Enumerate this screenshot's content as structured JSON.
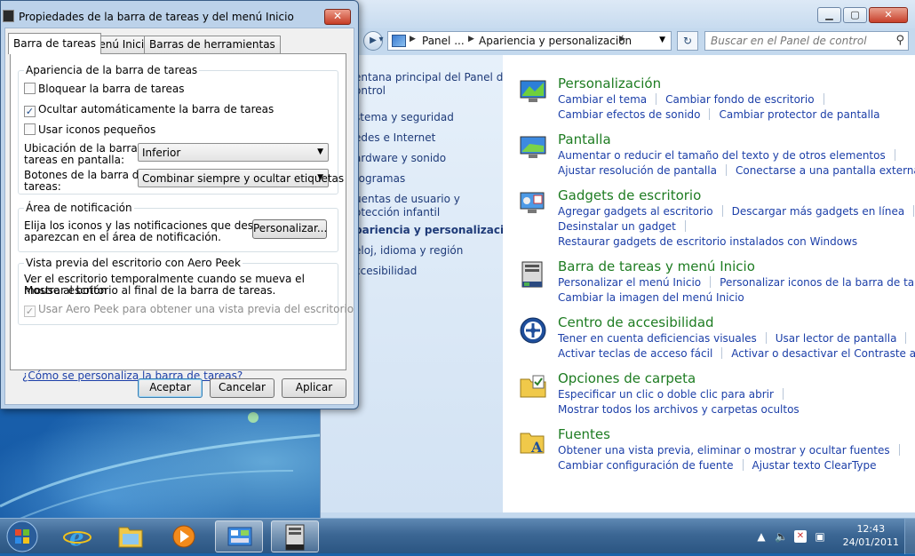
{
  "dialog": {
    "title": "Propiedades de la barra de tareas y del menú Inicio",
    "close": "✕",
    "tabs": [
      "Barra de tareas",
      "Menú Inicio",
      "Barras de herramientas"
    ],
    "appearance": {
      "title": "Apariencia de la barra de tareas",
      "lock": {
        "label": "Bloquear la barra de tareas",
        "checked": false
      },
      "autohide": {
        "label": "Ocultar automáticamente la barra de tareas",
        "checked": true
      },
      "small_icons": {
        "label": "Usar iconos pequeños",
        "checked": false
      },
      "location_label_1": "Ubicación de la barra de",
      "location_label_2": "tareas en pantalla:",
      "location_value": "Inferior",
      "buttons_label_1": "Botones de la barra de",
      "buttons_label_2": "tareas:",
      "buttons_value": "Combinar siempre y ocultar etiquetas"
    },
    "notification": {
      "title": "Área de notificación",
      "text_1": "Elija los iconos y las notificaciones que desea que",
      "text_2": "aparezcan en el área de notificación.",
      "customize": "Personalizar..."
    },
    "aero": {
      "title": "Vista previa del escritorio con Aero Peek",
      "text_1": "Ver el escritorio temporalmente cuando se mueva el mouse al botón",
      "text_2": "Mostrar escritorio al final de la barra de tareas.",
      "use_peek": {
        "label": "Usar Aero Peek para obtener una vista previa del escritorio",
        "checked": true
      }
    },
    "help_link": "¿Cómo se personaliza la barra de tareas?",
    "ok": "Aceptar",
    "cancel": "Cancelar",
    "apply": "Aplicar"
  },
  "control_panel": {
    "address": {
      "crumb_1": "Panel ...",
      "crumb_2": "Apariencia y personalización"
    },
    "search_placeholder": "Buscar en el Panel de control",
    "sidebar": [
      {
        "label": "entana principal del Panel de",
        "bold": false
      },
      {
        "label": "ontrol",
        "bold": false
      },
      {
        "label": "stema y seguridad",
        "bold": false
      },
      {
        "label": "edes e Internet",
        "bold": false
      },
      {
        "label": "ardware y sonido",
        "bold": false
      },
      {
        "label": "rogramas",
        "bold": false
      },
      {
        "label": "uentas de usuario y",
        "bold": false
      },
      {
        "label": "otección infantil",
        "bold": false
      },
      {
        "label": "pariencia y personalización",
        "bold": true
      },
      {
        "label": "eloj, idioma y región",
        "bold": false
      },
      {
        "label": "ccesibilidad",
        "bold": false
      }
    ],
    "categories": [
      {
        "title": "Personalización",
        "icon": "personalization-icon",
        "rows": [
          [
            "Cambiar el tema",
            "Cambiar fondo de escritorio"
          ],
          [
            "Cambiar efectos de sonido",
            "Cambiar protector de pantalla"
          ]
        ]
      },
      {
        "title": "Pantalla",
        "icon": "display-icon",
        "rows": [
          [
            "Aumentar o reducir el tamaño del texto y de otros elementos"
          ],
          [
            "Ajustar resolución de pantalla",
            "Conectarse a una pantalla externa"
          ]
        ]
      },
      {
        "title": "Gadgets de escritorio",
        "icon": "gadgets-icon",
        "rows": [
          [
            "Agregar gadgets al escritorio",
            "Descargar más gadgets en línea"
          ],
          [
            "Desinstalar un gadget"
          ],
          [
            "Restaurar gadgets de escritorio instalados con Windows"
          ]
        ]
      },
      {
        "title": "Barra de tareas y menú Inicio",
        "icon": "taskbar-icon",
        "rows": [
          [
            "Personalizar el menú Inicio",
            "Personalizar iconos de la barra de tareas"
          ],
          [
            "Cambiar la imagen del menú Inicio"
          ]
        ]
      },
      {
        "title": "Centro de accesibilidad",
        "icon": "accessibility-icon",
        "rows": [
          [
            "Tener en cuenta deficiencias visuales",
            "Usar lector de pantalla"
          ],
          [
            "Activar teclas de acceso fácil",
            "Activar o desactivar el Contraste alto"
          ]
        ]
      },
      {
        "title": "Opciones de carpeta",
        "icon": "folder-options-icon",
        "rows": [
          [
            "Especificar un clic o doble clic para abrir"
          ],
          [
            "Mostrar todos los archivos y carpetas ocultos"
          ]
        ]
      },
      {
        "title": "Fuentes",
        "icon": "fonts-icon",
        "rows": [
          [
            "Obtener una vista previa, eliminar o mostrar y ocultar fuentes"
          ],
          [
            "Cambiar configuración de fuente",
            "Ajustar texto ClearType"
          ]
        ]
      }
    ]
  },
  "taskbar": {
    "time": "12:43",
    "date": "24/01/2011"
  }
}
